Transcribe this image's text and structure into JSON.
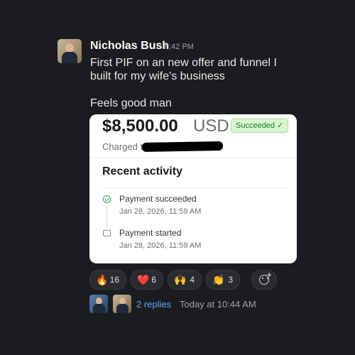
{
  "message": {
    "author": "Nicholas Bush",
    "time": "6:42 PM",
    "text_line1": "First PIF on an new offer and funnel I built for my wife's business",
    "text_line2": "Feels good man"
  },
  "payment_card": {
    "amount": "$8,500.00",
    "currency": "USD",
    "status_badge": "Succeeded ✓",
    "charged_label": "Charged t",
    "recent_activity_title": "Recent activity",
    "events": [
      {
        "title": "Payment succeeded",
        "date": "Jan 28, 2026, 11:59 AM",
        "icon": "check-circle-icon"
      },
      {
        "title": "Payment started",
        "date": "Jan 28, 2026, 11:59 AM",
        "icon": "card-icon"
      }
    ],
    "colors": {
      "success": "#3aa34a",
      "badge_bg": "#d8f5d0"
    }
  },
  "reactions": [
    {
      "emoji": "🔥",
      "count": "16",
      "name": "fire"
    },
    {
      "emoji": "❤️",
      "count": "6",
      "name": "heart"
    },
    {
      "emoji": "🙌",
      "count": "4",
      "name": "raised-hands"
    },
    {
      "emoji": "👏",
      "count": "3",
      "name": "clapping-hands"
    }
  ],
  "thread": {
    "replies": "2 replies",
    "last_reply": "Today at 10:44 AM"
  }
}
